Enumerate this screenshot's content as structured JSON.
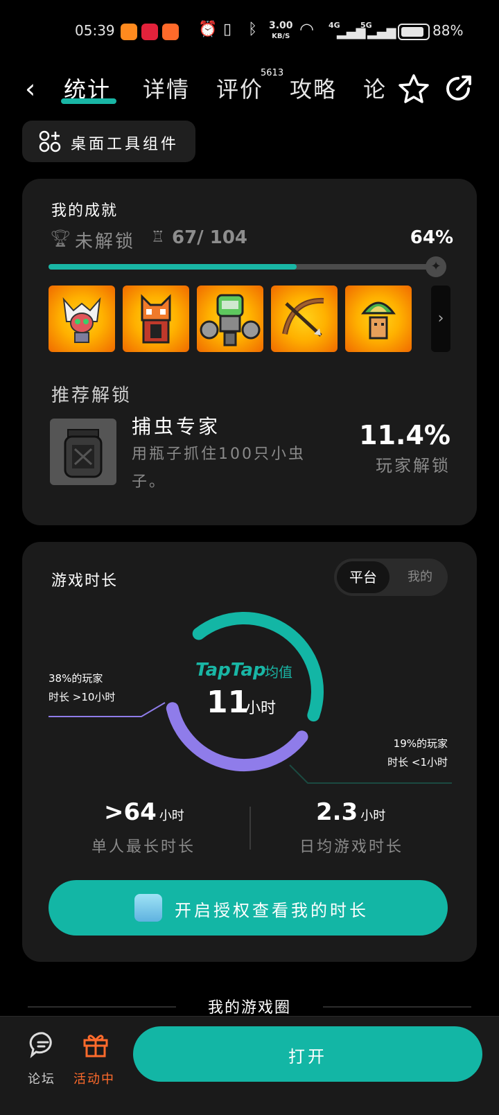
{
  "status_bar": {
    "time": "05:39",
    "net_speed": "3.00",
    "net_speed_unit": "KB/S",
    "net1": "4G",
    "net2": "5G",
    "battery": "88%",
    "battery_level": 0.88
  },
  "nav": {
    "tabs": [
      "统计",
      "详情",
      "评价",
      "攻略",
      "论坛"
    ],
    "review_count": "5613"
  },
  "widget_button": "桌面工具组件",
  "achievements": {
    "title": "我的成就",
    "locked_label": "未解锁",
    "count": "67/ 104",
    "percent": "64%",
    "progress_fraction": 0.64,
    "badges": [
      "badge-1",
      "badge-2",
      "badge-3",
      "badge-4",
      "badge-5"
    ],
    "recommend_title": "推荐解锁",
    "recommend": {
      "name": "捕虫专家",
      "desc": "用瓶子抓住100只小虫子。",
      "percent": "11.4%",
      "percent_label": "玩家解锁"
    }
  },
  "playtime": {
    "title": "游戏时长",
    "toggle": [
      "平台",
      "我的"
    ],
    "left_annotation": [
      "38%的玩家",
      "时长 >10小时"
    ],
    "right_annotation": [
      "19%的玩家",
      "时长 <1小时"
    ],
    "center_brand": "TapTap",
    "center_sub": "均值",
    "center_value": "11",
    "center_unit": "小时",
    "stats": [
      {
        "value": ">64",
        "unit": "小时",
        "label": "单人最长时长"
      },
      {
        "value": "2.3",
        "unit": "小时",
        "label": "日均游戏时长"
      }
    ],
    "auth_button": "开启授权查看我的时长"
  },
  "circle_title": "我的游戏圈",
  "bottom": {
    "forum": "论坛",
    "event": "活动中",
    "open": "打开"
  },
  "chart_data": {
    "type": "donut",
    "segments": [
      {
        "label": "38%的玩家 时长 >10小时",
        "value": 38,
        "color": "#8f7cea"
      },
      {
        "label": "19%的玩家 时长 <1小时",
        "value": 19,
        "color": "#1b4a41"
      },
      {
        "label": "",
        "value": 43,
        "color": "#13b6a5"
      }
    ],
    "center": "11 小时"
  },
  "colors": {
    "accent": "#13b6a5",
    "card": "#1b1b1b",
    "purple": "#8f7cea",
    "orange": "#ff6b2c"
  }
}
